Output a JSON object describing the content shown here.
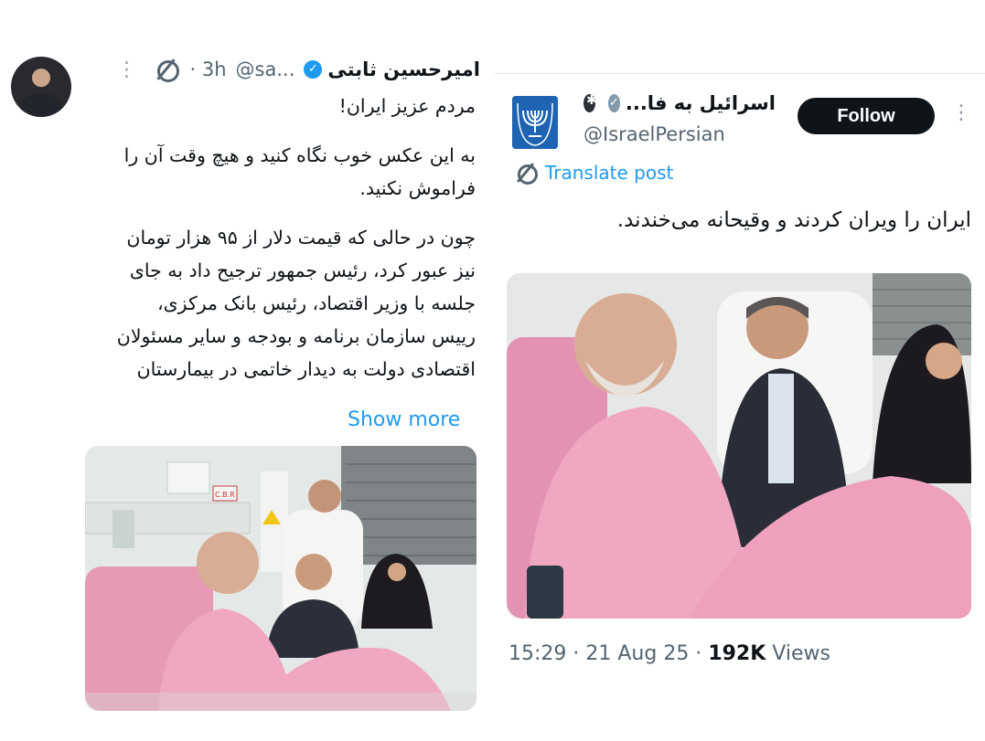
{
  "left_tweet": {
    "name": "امیرحسین ثابتی",
    "handle": "@sa...",
    "time": "· 3h",
    "lines": [
      "مردم عزیز ایران!",
      "",
      "به این عکس خوب نگاه کنید و هیچ وقت آن را",
      "فراموش نکنید.",
      "",
      "چون در حالی که قیمت دلار از ۹۵ هزار تومان",
      "نیز عبور کرد، رئیس جمهور ترجیح داد به جای",
      "جلسه با وزیر اقتصاد، رئیس بانک مرکزی،",
      "رییس سازمان برنامه و بودجه و سایر مسئولان",
      "اقتصادی دولت به دیدار خاتمی در بیمارستان"
    ],
    "show_more": "Show more",
    "photo_label": "C.B.R"
  },
  "right_tweet": {
    "name": "اسرائیل به فا...",
    "handle": "@IsraelPersian",
    "follow_label": "Follow",
    "translate_label": "Translate post",
    "text": "ایران را ویران کردند و وقیحانه می‌خندند.",
    "time": "15:29 · 21 Aug 25 ·",
    "views_count": "192K",
    "views_label": "Views"
  },
  "colors": {
    "accent": "#1d9bf0",
    "muted": "#536471",
    "follow_bg": "#0f1419",
    "gown_pink": "#f0a8c2"
  }
}
